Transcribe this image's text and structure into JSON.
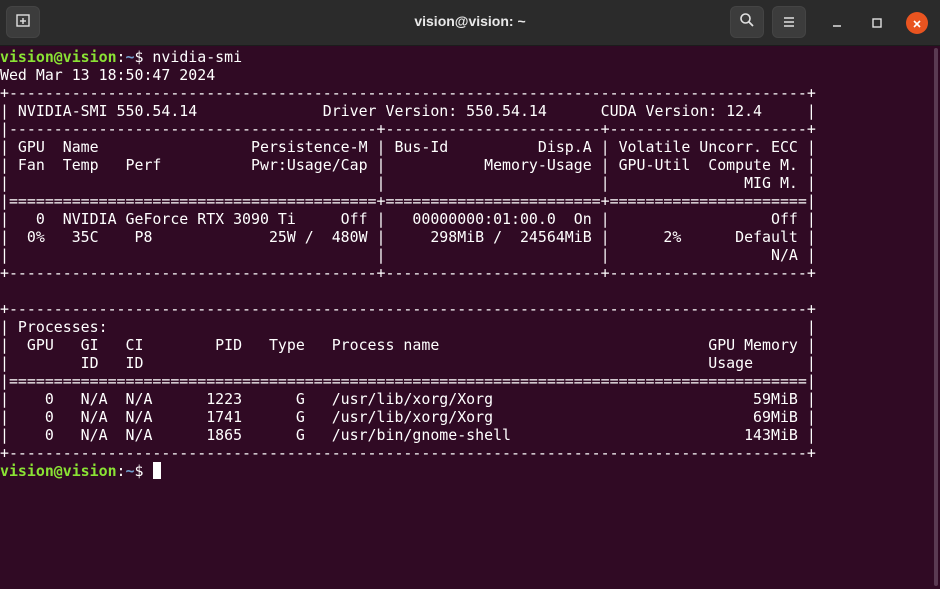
{
  "window": {
    "title": "vision@vision: ~",
    "new_tab_icon": "new-tab-icon",
    "search_icon": "search-icon",
    "menu_icon": "hamburger-menu-icon",
    "minimize_icon": "minimize-icon",
    "maximize_icon": "maximize-icon",
    "close_icon": "close-icon",
    "close_color": "#e95420"
  },
  "colors": {
    "background": "#300a24",
    "prompt_user": "#8ae234",
    "prompt_path": "#729fcf",
    "text": "#ffffff"
  },
  "prompt1": {
    "user_host": "vision@vision",
    "separator": ":",
    "path": "~",
    "symbol": "$ ",
    "command": "nvidia-smi"
  },
  "prompt2": {
    "user_host": "vision@vision",
    "separator": ":",
    "path": "~",
    "symbol": "$ "
  },
  "timestamp": "Wed Mar 13 18:50:47 2024",
  "smi": {
    "border": "+-----------------------------------------------------------------------------------------+",
    "version_line": "| NVIDIA-SMI 550.54.14              Driver Version: 550.54.14      CUDA Version: 12.4     |",
    "sep_dash": "|-----------------------------------------+------------------------+----------------------+",
    "header1": "| GPU  Name                 Persistence-M | Bus-Id          Disp.A | Volatile Uncorr. ECC |",
    "header2": "| Fan  Temp   Perf          Pwr:Usage/Cap |           Memory-Usage | GPU-Util  Compute M. |",
    "header3": "|                                         |                        |               MIG M. |",
    "sep_eq": "|=========================================+========================+======================|",
    "gpu_row1": "|   0  NVIDIA GeForce RTX 3090 Ti     Off |   00000000:01:00.0  On |                  Off |",
    "gpu_row2": "|  0%   35C    P8             25W /  480W |     298MiB /  24564MiB |      2%      Default |",
    "gpu_row3": "|                                         |                        |                  N/A |",
    "gpu_bottom": "+-----------------------------------------+------------------------+----------------------+",
    "proc_title": "| Processes:                                                                              |",
    "proc_header1": "|  GPU   GI   CI        PID   Type   Process name                              GPU Memory |",
    "proc_header2": "|        ID   ID                                                               Usage      |",
    "proc_sep": "|=========================================================================================|",
    "processes": [
      "|    0   N/A  N/A      1223      G   /usr/lib/xorg/Xorg                             59MiB |",
      "|    0   N/A  N/A      1741      G   /usr/lib/xorg/Xorg                             69MiB |",
      "|    0   N/A  N/A      1865      G   /usr/bin/gnome-shell                          143MiB |"
    ]
  }
}
